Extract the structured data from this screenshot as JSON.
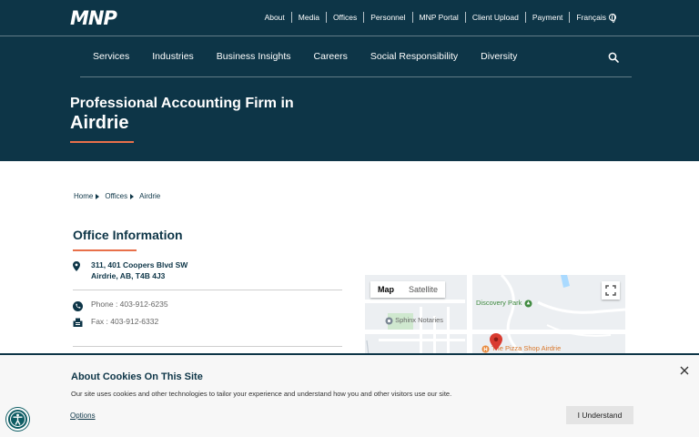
{
  "brand": {
    "logo": "MNP"
  },
  "utility_nav": [
    {
      "label": "About"
    },
    {
      "label": "Media"
    },
    {
      "label": "Offices"
    },
    {
      "label": "Personnel"
    },
    {
      "label": "MNP Portal"
    },
    {
      "label": "Client Upload"
    },
    {
      "label": "Payment"
    },
    {
      "label": "Français"
    }
  ],
  "main_nav": [
    {
      "label": "Services"
    },
    {
      "label": "Industries"
    },
    {
      "label": "Business Insights"
    },
    {
      "label": "Careers"
    },
    {
      "label": "Social Responsibility"
    },
    {
      "label": "Diversity"
    }
  ],
  "hero": {
    "title_line1": "Professional Accounting Firm in",
    "title_line2": "Airdrie"
  },
  "breadcrumb": [
    "Home",
    "Offices",
    "Airdrie"
  ],
  "office": {
    "heading": "Office Information",
    "address_line1": "311, 401 Coopers Blvd SW",
    "address_line2": "Airdrie, AB, T4B 4J3",
    "phone": "Phone : 403-912-6235",
    "fax": "Fax : 403-912-6332"
  },
  "map": {
    "tabs": [
      "Map",
      "Satellite"
    ],
    "places": [
      "Discovery Park",
      "Sphinx Notaries",
      "The Pizza Shop Airdrie"
    ]
  },
  "cookie_banner": {
    "title": "About Cookies On This Site",
    "text": "Our site uses cookies and other technologies to tailor your experience and understand how you and other visitors use our site.",
    "options_label": "Options",
    "accept_label": "I Understand"
  },
  "colors": {
    "header_bg": "#0d3547",
    "accent": "#e8704a",
    "banner_bg": "#f7f7f7"
  }
}
